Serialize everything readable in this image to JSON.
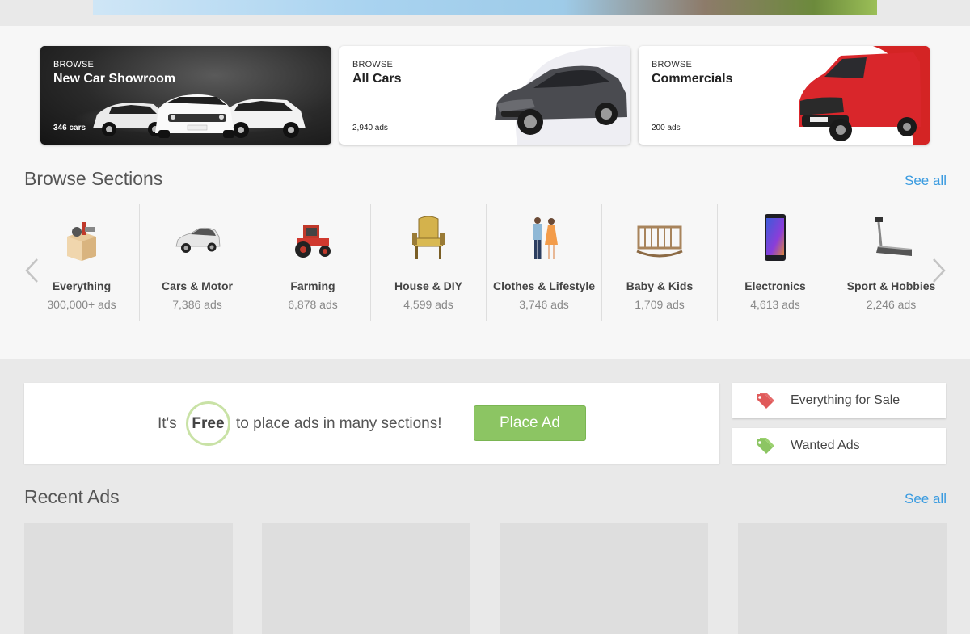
{
  "colors": {
    "accent_link": "#3a9be0",
    "place_ad_green": "#8cc563",
    "sale_tag": "#e05a5a",
    "wanted_tag": "#8cc563"
  },
  "cards": [
    {
      "kicker": "BROWSE",
      "title": "New Car Showroom",
      "count": "346 cars"
    },
    {
      "kicker": "BROWSE",
      "title": "All Cars",
      "count": "2,940 ads"
    },
    {
      "kicker": "BROWSE",
      "title": "Commercials",
      "count": "200 ads"
    }
  ],
  "browse": {
    "title": "Browse Sections",
    "see_all": "See all",
    "categories": [
      {
        "name": "Everything",
        "count": "300,000+ ads",
        "icon": "box-icon"
      },
      {
        "name": "Cars & Motor",
        "count": "7,386 ads",
        "icon": "car-icon"
      },
      {
        "name": "Farming",
        "count": "6,878 ads",
        "icon": "tractor-icon"
      },
      {
        "name": "House & DIY",
        "count": "4,599 ads",
        "icon": "armchair-icon"
      },
      {
        "name": "Clothes & Lifestyle",
        "count": "3,746 ads",
        "icon": "people-icon"
      },
      {
        "name": "Baby & Kids",
        "count": "1,709 ads",
        "icon": "crib-icon"
      },
      {
        "name": "Electronics",
        "count": "4,613 ads",
        "icon": "phone-icon"
      },
      {
        "name": "Sport & Hobbies",
        "count": "2,246 ads",
        "icon": "treadmill-icon"
      }
    ]
  },
  "promo": {
    "prefix": "It's",
    "free": "Free",
    "suffix": "to place ads in many sections!",
    "button": "Place Ad"
  },
  "side_links": [
    {
      "label": "Everything for Sale",
      "icon": "tag-icon"
    },
    {
      "label": "Wanted Ads",
      "icon": "tag-icon"
    }
  ],
  "recent": {
    "title": "Recent Ads",
    "see_all": "See all"
  }
}
